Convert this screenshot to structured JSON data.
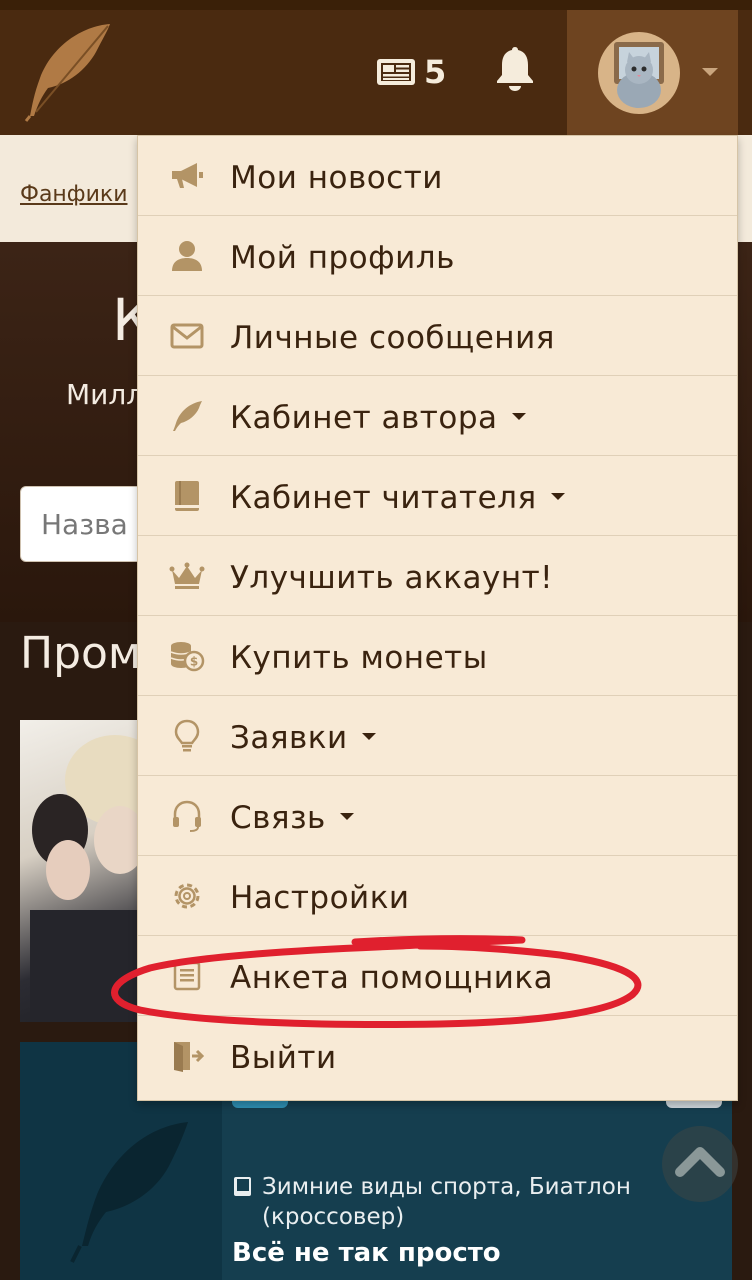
{
  "header": {
    "news_count": "5",
    "logo_icon": "feather-logo-icon",
    "news_icon": "newspaper-icon",
    "bell_icon": "bell-icon",
    "avatar_icon": "cat-avatar",
    "colors": {
      "bar": "#4a2a10",
      "user_box": "#6e4420",
      "text": "#f5ecdc"
    }
  },
  "breadcrumb": {
    "link": "Фанфики"
  },
  "hero": {
    "title_fragment": "К",
    "subtitle_fragment": "Милл",
    "search_placeholder": "Назва"
  },
  "section": {
    "title_fragment": "Пром"
  },
  "card": {
    "fandom": "Зимние виды спорта, Биатлон (кроссовер)",
    "title": "Всё не так просто"
  },
  "menu": {
    "items": [
      {
        "label": "Мои новости",
        "icon": "megaphone-icon",
        "caret": false
      },
      {
        "label": "Мой профиль",
        "icon": "user-icon",
        "caret": false
      },
      {
        "label": "Личные сообщения",
        "icon": "envelope-icon",
        "caret": false
      },
      {
        "label": "Кабинет автора",
        "icon": "feather-icon",
        "caret": true
      },
      {
        "label": "Кабинет читателя",
        "icon": "book-icon",
        "caret": true
      },
      {
        "label": "Улучшить аккаунт!",
        "icon": "crown-icon",
        "caret": false
      },
      {
        "label": "Купить монеты",
        "icon": "coins-icon",
        "caret": false
      },
      {
        "label": "Заявки",
        "icon": "lightbulb-icon",
        "caret": true
      },
      {
        "label": "Связь",
        "icon": "headset-icon",
        "caret": true
      },
      {
        "label": "Настройки",
        "icon": "gear-icon",
        "caret": false
      },
      {
        "label": "Анкета помощника",
        "icon": "document-icon",
        "caret": false
      },
      {
        "label": "Выйти",
        "icon": "logout-icon",
        "caret": false
      }
    ],
    "colors": {
      "bg": "#f8ead6",
      "text": "#3a230f",
      "icon": "#b39466"
    }
  },
  "annotation": {
    "type": "hand-drawn-circle",
    "color": "#e0202e",
    "target": "Анкета помощника"
  }
}
